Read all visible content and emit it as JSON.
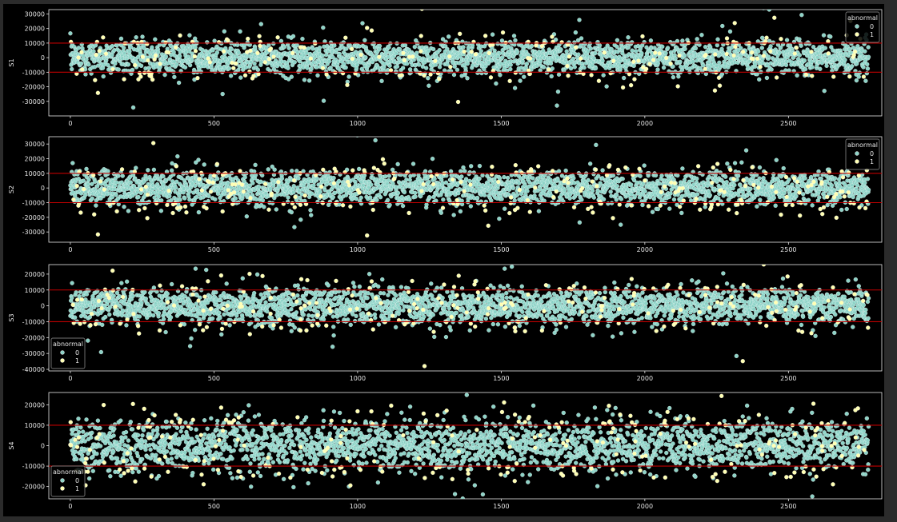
{
  "chart_data": [
    {
      "type": "scatter",
      "ylabel": "S1",
      "xlim": [
        -75,
        2825
      ],
      "ylim": [
        -40000,
        33000
      ],
      "xticks": [
        0,
        500,
        1000,
        1500,
        2000,
        2500
      ],
      "yticks": [
        -30000,
        -20000,
        -10000,
        0,
        10000,
        20000,
        30000
      ],
      "hlines": [
        10000,
        -10000
      ],
      "legend": {
        "title": "abnormal",
        "entries": [
          "0",
          "1"
        ],
        "position": "top-right"
      },
      "n_points": 2780,
      "spread": 6000,
      "series": [
        {
          "name": "0",
          "color": "#8dd3c7"
        },
        {
          "name": "1",
          "color": "#ffffb3"
        }
      ]
    },
    {
      "type": "scatter",
      "ylabel": "S2",
      "xlim": [
        -75,
        2825
      ],
      "ylim": [
        -37000,
        35000
      ],
      "xticks": [
        0,
        500,
        1000,
        1500,
        2000,
        2500
      ],
      "yticks": [
        -30000,
        -20000,
        -10000,
        0,
        10000,
        20000,
        30000
      ],
      "hlines": [
        10000,
        -10000
      ],
      "legend": {
        "title": "abnormal",
        "entries": [
          "0",
          "1"
        ],
        "position": "top-right"
      },
      "n_points": 2780,
      "spread": 6000,
      "series": [
        {
          "name": "0",
          "color": "#8dd3c7"
        },
        {
          "name": "1",
          "color": "#ffffb3"
        }
      ]
    },
    {
      "type": "scatter",
      "ylabel": "S3",
      "xlim": [
        -75,
        2825
      ],
      "ylim": [
        -41000,
        26000
      ],
      "xticks": [
        0,
        500,
        1000,
        1500,
        2000,
        2500
      ],
      "yticks": [
        -40000,
        -30000,
        -20000,
        -10000,
        0,
        10000,
        20000
      ],
      "hlines": [
        10000,
        -10000
      ],
      "legend": {
        "title": "abnormal",
        "entries": [
          "0",
          "1"
        ],
        "position": "bottom-left"
      },
      "n_points": 2780,
      "spread": 6000,
      "series": [
        {
          "name": "0",
          "color": "#8dd3c7"
        },
        {
          "name": "1",
          "color": "#ffffb3"
        }
      ]
    },
    {
      "type": "scatter",
      "ylabel": "S4",
      "xlim": [
        -75,
        2825
      ],
      "ylim": [
        -26000,
        26000
      ],
      "xticks": [
        0,
        500,
        1000,
        1500,
        2000,
        2500
      ],
      "yticks": [
        -20000,
        -10000,
        0,
        10000,
        20000
      ],
      "hlines": [
        10000,
        -10000
      ],
      "legend": {
        "title": "abnormal",
        "entries": [
          "0",
          "1"
        ],
        "position": "bottom-left"
      },
      "n_points": 2780,
      "spread": 6500,
      "series": [
        {
          "name": "0",
          "color": "#8dd3c7"
        },
        {
          "name": "1",
          "color": "#ffffb3"
        }
      ]
    }
  ],
  "colors": {
    "background": "#000000",
    "frame": "#2b2b2b",
    "axis": "#e6e6e6",
    "hline": "#c00000"
  }
}
